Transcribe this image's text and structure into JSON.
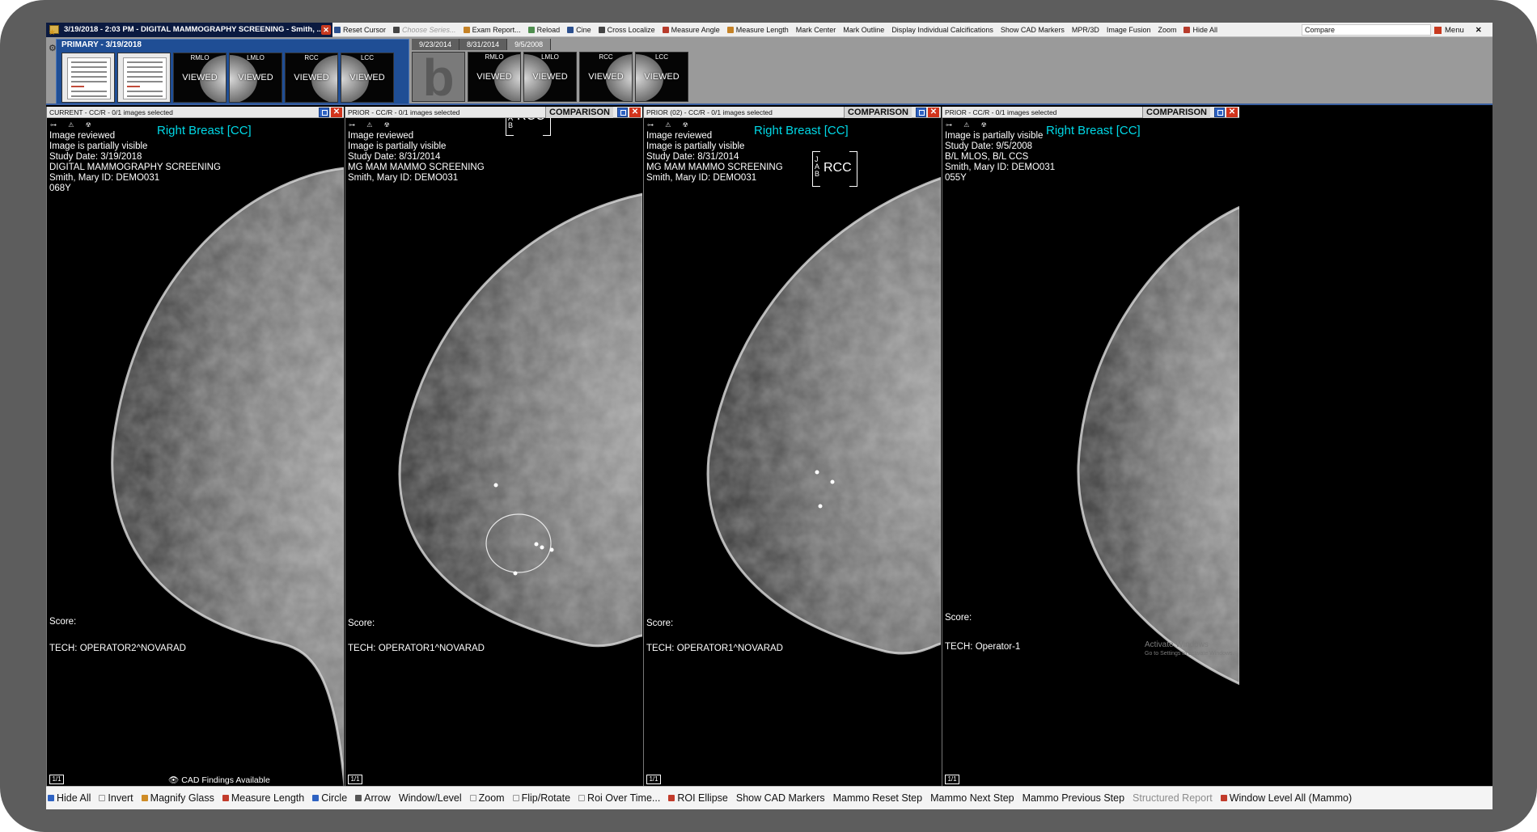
{
  "window": {
    "study_title": "3/19/2018 - 2:03 PM - DIGITAL MAMMOGRAPHY SCREENING - Smith, ...",
    "close_glyph": "✕"
  },
  "top_toolbar": {
    "items": [
      {
        "label": "Reset Cursor",
        "icon": "reset-cursor-icon",
        "enabled": true
      },
      {
        "label": "Choose Series...",
        "icon": "choose-series-icon",
        "enabled": false
      },
      {
        "label": "Exam Report...",
        "icon": "exam-report-icon",
        "enabled": true
      },
      {
        "label": "Reload",
        "icon": "reload-icon",
        "enabled": true
      },
      {
        "label": "Cine",
        "icon": "cine-icon",
        "enabled": true
      },
      {
        "label": "Cross Localize",
        "icon": "cross-localize-icon",
        "enabled": true
      },
      {
        "label": "Measure Angle",
        "icon": "measure-angle-icon",
        "enabled": true
      },
      {
        "label": "Measure Length",
        "icon": "measure-length-icon",
        "enabled": true
      },
      {
        "label": "Mark Center",
        "icon": "",
        "enabled": true
      },
      {
        "label": "Mark Outline",
        "icon": "",
        "enabled": true
      },
      {
        "label": "Display Individual Calcifications",
        "icon": "",
        "enabled": true
      },
      {
        "label": "Show CAD Markers",
        "icon": "",
        "enabled": true
      },
      {
        "label": "MPR/3D",
        "icon": "",
        "enabled": true
      },
      {
        "label": "Image Fusion",
        "icon": "",
        "enabled": true
      },
      {
        "label": "Zoom",
        "icon": "",
        "enabled": true
      },
      {
        "label": "Hide All",
        "icon": "hide-all-icon",
        "enabled": true
      }
    ],
    "compare_value": "Compare",
    "menu_label": "Menu",
    "menu_close": "✕"
  },
  "thumbnail_strip": {
    "primary_label": "PRIMARY - 3/19/2018",
    "primary_thumbs": [
      {
        "type": "doc",
        "label": "",
        "status": ""
      },
      {
        "type": "doc",
        "label": "",
        "status": ""
      },
      {
        "type": "image",
        "label": "RMLO",
        "status": "VIEWED"
      },
      {
        "type": "image",
        "label": "LMLO",
        "status": "VIEWED"
      },
      {
        "type": "image",
        "label": "RCC",
        "status": "VIEWED"
      },
      {
        "type": "image",
        "label": "LCC",
        "status": "VIEWED"
      }
    ],
    "prior_tabs": [
      "9/23/2014",
      "8/31/2014",
      "9/5/2008"
    ],
    "prior_big_letter": "b",
    "prior_thumbs": [
      {
        "label": "RMLO",
        "status": "VIEWED"
      },
      {
        "label": "LMLO",
        "status": "VIEWED"
      },
      {
        "label": "RCC",
        "status": "VIEWED"
      },
      {
        "label": "LCC",
        "status": "VIEWED"
      }
    ]
  },
  "viewports": [
    {
      "header": "CURRENT - CC/R - 0/1 images selected",
      "comparison_label": "",
      "side_label": "Right Breast [CC]",
      "info_lines": [
        "Image reviewed",
        "Image is partially visible",
        "Study Date: 3/19/2018",
        "DIGITAL MAMMOGRAPHY SCREENING",
        "Smith, Mary  ID: DEMO031",
        "068Y"
      ],
      "score_label": "Score:",
      "tech": "TECH: OPERATOR2^NOVARAD",
      "page": "1/1",
      "footer_note": "CAD Findings Available"
    },
    {
      "header": "PRIOR - CC/R - 0/1 images selected",
      "comparison_label": "COMPARISON",
      "side_label": "",
      "bracket_label": "RCC",
      "bracket_letters": [
        "A",
        "B"
      ],
      "info_lines": [
        "Image reviewed",
        "Image is partially visible",
        "Study Date: 8/31/2014",
        "MG MAM MAMMO SCREENING",
        "Smith, Mary  ID: DEMO031"
      ],
      "score_label": "Score:",
      "tech": "TECH: OPERATOR1^NOVARAD",
      "page": "1/1"
    },
    {
      "header": "PRIOR (02) - CC/R - 0/1 images selected",
      "comparison_label": "COMPARISON",
      "side_label": "Right Breast [CC]",
      "bracket_label": "RCC",
      "bracket_letters": [
        "J",
        "A",
        "B"
      ],
      "info_lines": [
        "Image reviewed",
        "Image is partially visible",
        "Study Date: 8/31/2014",
        "MG MAM MAMMO SCREENING",
        "Smith, Mary  ID: DEMO031"
      ],
      "score_label": "Score:",
      "tech": "TECH: OPERATOR1^NOVARAD",
      "page": "1/1"
    },
    {
      "header": "PRIOR - CC/R - 0/1 images selected",
      "comparison_label": "COMPARISON",
      "side_label": "Right Breast [CC]",
      "info_lines": [
        "Image is partially visible",
        "Study Date: 9/5/2008",
        "B/L MLOS, B/L CCS",
        "Smith, Mary  ID: DEMO031",
        "055Y"
      ],
      "score_label": "Score:",
      "tech": "TECH: Operator-1",
      "page": "1/1",
      "watermark_title": "Activate Windows",
      "watermark_sub": "Go to Settings to activate Windows."
    }
  ],
  "bottom_toolbar": {
    "items": [
      {
        "label": "Hide All",
        "icon": "hide-all-icon",
        "enabled": true
      },
      {
        "label": "Invert",
        "icon": "invert-icon",
        "enabled": true
      },
      {
        "label": "Magnify Glass",
        "icon": "magnify-glass-icon",
        "enabled": true
      },
      {
        "label": "Measure Length",
        "icon": "measure-length-icon",
        "enabled": true
      },
      {
        "label": "Circle",
        "icon": "circle-icon",
        "enabled": true
      },
      {
        "label": "Arrow",
        "icon": "arrow-icon",
        "enabled": true
      },
      {
        "label": "Window/Level",
        "icon": "",
        "enabled": true
      },
      {
        "label": "Zoom",
        "icon": "zoom-icon",
        "enabled": true
      },
      {
        "label": "Flip/Rotate",
        "icon": "flip-rotate-icon",
        "enabled": true
      },
      {
        "label": "Roi Over Time...",
        "icon": "roi-over-time-icon",
        "enabled": true
      },
      {
        "label": "ROI Ellipse",
        "icon": "roi-ellipse-icon",
        "enabled": true
      },
      {
        "label": "Show CAD Markers",
        "icon": "",
        "enabled": true
      },
      {
        "label": "Mammo Reset Step",
        "icon": "",
        "enabled": true
      },
      {
        "label": "Mammo Next Step",
        "icon": "",
        "enabled": true
      },
      {
        "label": "Mammo Previous Step",
        "icon": "",
        "enabled": true
      },
      {
        "label": "Structured Report",
        "icon": "",
        "enabled": false
      },
      {
        "label": "Window Level All (Mammo)",
        "icon": "window-level-all-icon",
        "enabled": true
      }
    ]
  },
  "colors": {
    "accent_blue": "#1f4e95",
    "side_label_cyan": "#00d8e6",
    "close_red": "#d2341c",
    "title_bar_navy": "#0b1a40"
  }
}
